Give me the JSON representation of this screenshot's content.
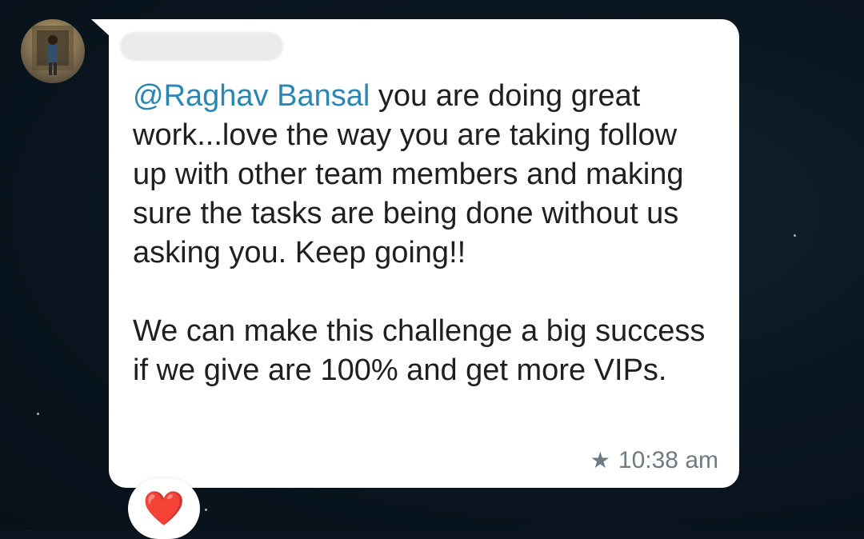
{
  "chat": {
    "avatar_icon": "user-avatar-icon",
    "sender_name": "",
    "message": {
      "mention": "@Raghav Bansal",
      "para1_rest": " you are doing great work...love the way you are taking follow up with other team members and making sure the tasks are being done without us asking you. Keep going!!",
      "para2": "We can make this challenge a big success if we give are 100% and get more VIPs."
    },
    "time": "10:38 am",
    "starred_icon": "star-icon",
    "reaction": "❤️",
    "colors": {
      "mention": "#2b86b3",
      "bubble": "#ffffff",
      "background": "#0b1620",
      "meta": "#6f7a82"
    }
  }
}
